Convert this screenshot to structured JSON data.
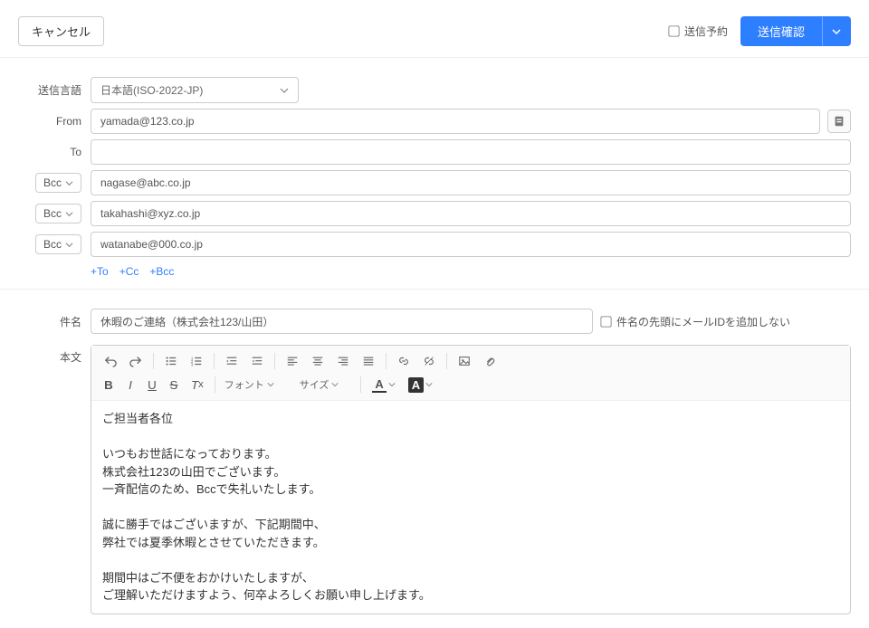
{
  "top": {
    "cancel": "キャンセル",
    "schedule_label": "送信予約",
    "confirm": "送信確認"
  },
  "labels": {
    "lang": "送信言語",
    "from": "From",
    "to": "To",
    "bcc": "Bcc",
    "subject": "件名",
    "body": "本文",
    "add_to": "+To",
    "add_cc": "+Cc",
    "add_bcc": "+Bcc",
    "subject_noid": "件名の先頭にメールIDを追加しない",
    "font_label": "フォント",
    "size_label": "サイズ"
  },
  "values": {
    "lang": "日本語(ISO-2022-JP)",
    "from": "yamada@123.co.jp",
    "to": "",
    "bcc1": "nagase@abc.co.jp",
    "bcc2": "takahashi@xyz.co.jp",
    "bcc3": "watanabe@000.co.jp",
    "subject": "休暇のご連絡（株式会社123/山田）"
  },
  "body_text": "ご担当者各位\n\nいつもお世話になっております。\n株式会社123の山田でございます。\n一斉配信のため、Bccで失礼いたします。\n\n誠に勝手ではございますが、下記期間中、\n弊社では夏季休暇とさせていただきます。\n\n期間中はご不便をおかけいたしますが、\nご理解いただけますよう、何卒よろしくお願い申し上げます。"
}
